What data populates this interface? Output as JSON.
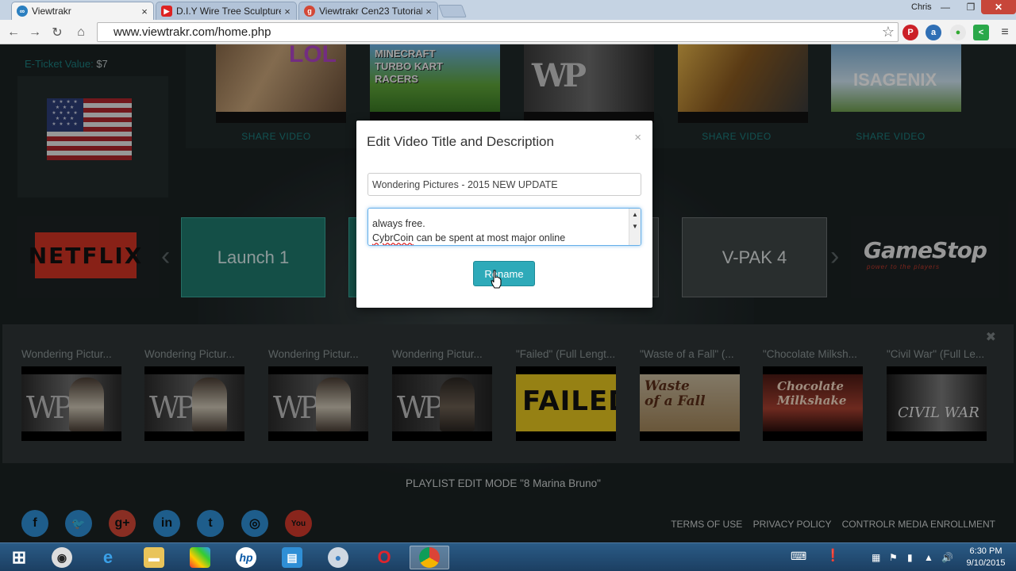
{
  "browser": {
    "tabs": [
      {
        "label": "Viewtrakr",
        "active": true,
        "icon": "viewtrakr-favicon-icon"
      },
      {
        "label": "D.I.Y Wire Tree Sculpture",
        "active": false,
        "icon": "youtube-favicon-icon"
      },
      {
        "label": "Viewtrakr Cen23 Tutorial",
        "active": false,
        "icon": "google-plus-favicon-icon"
      }
    ],
    "user": "Chris",
    "url": "www.viewtrakr.com/home.php"
  },
  "page": {
    "eticket_label": "E-Ticket Value:",
    "eticket_value": "$7",
    "top_thumbs": [
      {
        "overlay": "LOL"
      },
      {
        "overlay": "MINECRAFT TURBO KART RACERS"
      },
      {
        "overlay": "WP"
      },
      {
        "overlay": ""
      },
      {
        "overlay": "ISAGENIX"
      }
    ],
    "share_label": "SHARE VIDEO",
    "carousel": {
      "netflix": "NETFLIX",
      "slide1": "Launch 1",
      "slide4": "V-PAK 4",
      "gamestop": "GameStop",
      "gamestop_tag": "power to the players"
    },
    "playlist": [
      {
        "title": "Wondering Pictur...",
        "art": "wp"
      },
      {
        "title": "Wondering Pictur...",
        "art": "wp"
      },
      {
        "title": "Wondering Pictur...",
        "art": "wp"
      },
      {
        "title": "Wondering Pictur...",
        "art": "wp"
      },
      {
        "title": "\"Failed\" (Full Lengt...",
        "art": "failed",
        "art_text": "FAILED"
      },
      {
        "title": "\"Waste of a Fall\" (...",
        "art": "waste",
        "art_text": "Waste of a Fall"
      },
      {
        "title": "\"Chocolate Milksh...",
        "art": "chocolate",
        "art_text": "Chocolate Milkshake"
      },
      {
        "title": "\"Civil War\" (Full Le...",
        "art": "civil",
        "art_text": "CIVIL WAR"
      }
    ],
    "playlist_mode": "PLAYLIST EDIT MODE \"8 Marina Bruno\"",
    "footer": [
      "TERMS OF USE",
      "PRIVACY POLICY",
      "CONTROLR MEDIA ENROLLMENT"
    ]
  },
  "modal": {
    "title": "Edit Video Title and Description",
    "title_value": "Wondering Pictures - 2015 NEW UPDATE",
    "desc_line1": "always free.",
    "desc_line2_word": "CybrCoin",
    "desc_line2_rest": " can be spent at most major online",
    "button": "Rename"
  },
  "taskbar": {
    "time": "6:30 PM",
    "date": "9/10/2015"
  }
}
